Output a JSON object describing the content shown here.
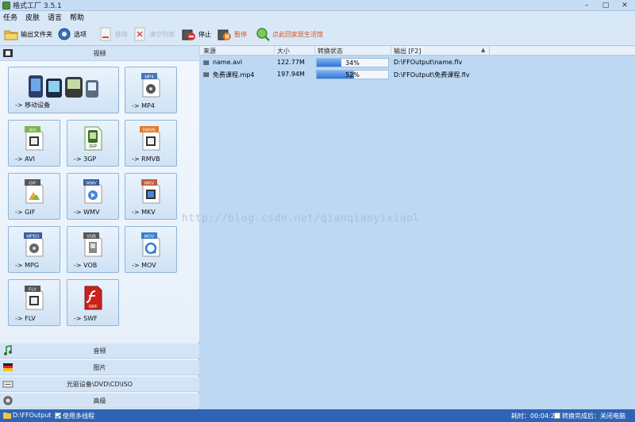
{
  "window": {
    "title": "格式工厂 3.5.1",
    "controls": [
      "–",
      "□",
      "✕"
    ]
  },
  "menu": [
    "任务",
    "皮肤",
    "语言",
    "帮助"
  ],
  "toolbar": {
    "output_folder": "输出文件夹",
    "options": "选项",
    "remove": "移除",
    "clear_list": "清空列表",
    "stop": "停止",
    "pause": "暂停",
    "family_life": "点此回家居生活馆"
  },
  "categories": {
    "video": "视频",
    "audio": "音频",
    "image": "图片",
    "rom": "光驱设备\\DVD\\CD\\ISO",
    "advanced": "高级"
  },
  "formats": [
    {
      "label": "-> 移动设备",
      "badge": ""
    },
    {
      "label": "-> MP4",
      "badge": "MP4"
    },
    {
      "label": "-> AVI",
      "badge": "AVI"
    },
    {
      "label": "-> 3GP",
      "badge": "3GP"
    },
    {
      "label": "-> RMVB",
      "badge": "RMVB"
    },
    {
      "label": "-> GIF",
      "badge": "GIF"
    },
    {
      "label": "-> WMV",
      "badge": "WMV"
    },
    {
      "label": "-> MKV",
      "badge": "MKV"
    },
    {
      "label": "-> MPG",
      "badge": "MPEG"
    },
    {
      "label": "-> VOB",
      "badge": "VOB"
    },
    {
      "label": "-> MOV",
      "badge": "MOV"
    },
    {
      "label": "-> FLV",
      "badge": "FLV"
    },
    {
      "label": "-> SWF",
      "badge": "SWF"
    }
  ],
  "list": {
    "columns": [
      "来源",
      "大小",
      "转换状态",
      "输出 [F2]"
    ],
    "rows": [
      {
        "source": "name.avi",
        "size": "122.77M",
        "progress": 34,
        "progress_text": "34%",
        "output": "D:\\FFOutput\\name.flv"
      },
      {
        "source": "免费课程.mp4",
        "size": "197.94M",
        "progress": 52,
        "progress_text": "52%",
        "output": "D:\\FFOutput\\免费课程.flv"
      }
    ]
  },
  "watermark": "http://blog.csdn.net/qianqianyixiaol",
  "status": {
    "output_path": "D:\\FFOutput",
    "multithread": "使用多线程",
    "elapsed": "耗时：00:04:29",
    "after_done": "转换完成后：关闭电脑"
  },
  "colors": {
    "statusbar": "#2f64b4",
    "progress": "#2f74d6",
    "list_bg": "#bcd8f3"
  }
}
